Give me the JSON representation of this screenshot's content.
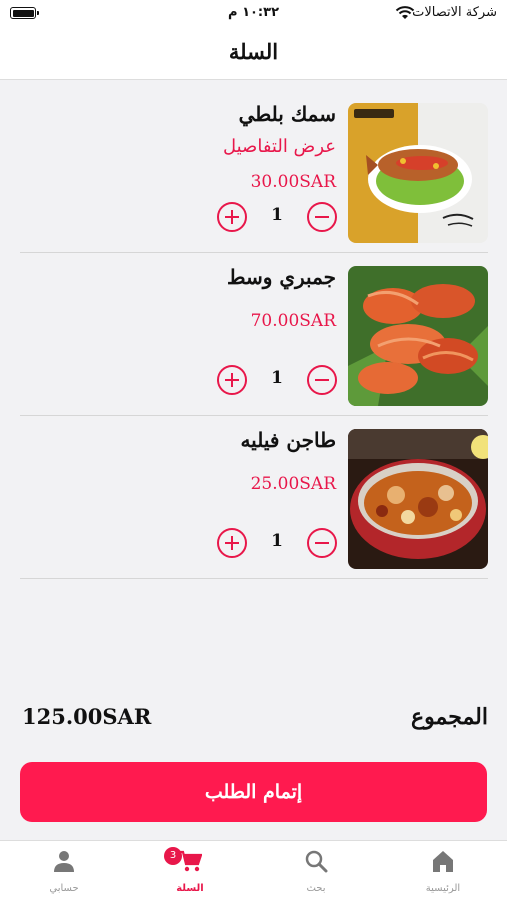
{
  "status_bar": {
    "carrier": "شركة الاتصالات",
    "time": "١٠:٣٢ م"
  },
  "header": {
    "title": "السلة"
  },
  "cart": {
    "items": [
      {
        "name": "سمك بلطي",
        "details_link": "عرض التفاصيل",
        "price": "30.00SAR",
        "quantity": "1",
        "image": "fish-dish"
      },
      {
        "name": "جمبري وسط",
        "price": "70.00SAR",
        "quantity": "1",
        "image": "shrimp-dish"
      },
      {
        "name": "طاجن فيليه",
        "price": "25.00SAR",
        "quantity": "1",
        "image": "tagine-dish"
      }
    ]
  },
  "total": {
    "label": "المجموع",
    "amount": "125.00SAR"
  },
  "checkout": {
    "label": "إتمام الطلب"
  },
  "tab_bar": {
    "tabs": [
      {
        "label": "حسابي",
        "icon": "person-icon"
      },
      {
        "label": "السلة",
        "icon": "cart-icon",
        "badge": "3",
        "active": true
      },
      {
        "label": "بحث",
        "icon": "search-icon"
      },
      {
        "label": "الرئيسية",
        "icon": "home-icon"
      }
    ]
  },
  "colors": {
    "accent": "#e8174a",
    "button": "#ff1a4f",
    "background": "#f2f2f4"
  }
}
